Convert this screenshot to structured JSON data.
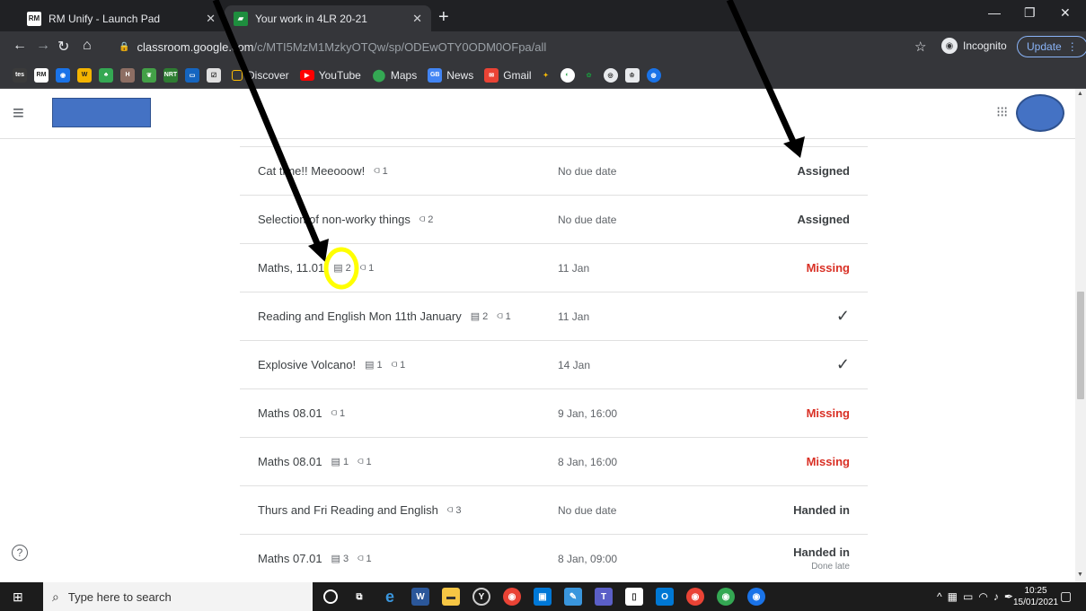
{
  "browser": {
    "tabs": [
      {
        "label": "RM Unify - Launch Pad",
        "favicon": "RM",
        "active": false
      },
      {
        "label": "Your work in 4LR 20-21",
        "favicon": "GC",
        "active": true
      }
    ],
    "url_host": "classroom.google.com",
    "url_path": "/c/MTI5MzM1MzkyOTQw/sp/ODEwOTY0ODM0OFpa/all",
    "incognito_label": "Incognito",
    "update_label": "Update",
    "bookmarks": [
      {
        "label": "Discover",
        "icon": "discover-icon"
      },
      {
        "label": "YouTube",
        "icon": "youtube-icon"
      },
      {
        "label": "Maps",
        "icon": "maps-icon"
      },
      {
        "label": "News",
        "icon": "news-icon"
      },
      {
        "label": "Gmail",
        "icon": "gmail-icon"
      }
    ],
    "colors": {
      "chrome_dark": "#202124",
      "chrome_toolbar": "#35363a",
      "accent_blue": "#8ab4f8"
    }
  },
  "work_items": [
    {
      "title": "Cat time!! Meeooow!",
      "comments": "",
      "attachments": "1",
      "due": "No due date",
      "status": "Assigned",
      "status_kind": "normal",
      "sub": ""
    },
    {
      "title": "Selection of non-worky things",
      "comments": "",
      "attachments": "2",
      "due": "No due date",
      "status": "Assigned",
      "status_kind": "normal",
      "sub": ""
    },
    {
      "title": "Maths, 11.01",
      "comments": "2",
      "attachments": "1",
      "due": "11 Jan",
      "status": "Missing",
      "status_kind": "missing",
      "sub": ""
    },
    {
      "title": "Reading and English Mon 11th January",
      "comments": "2",
      "attachments": "1",
      "due": "11 Jan",
      "status": "✓",
      "status_kind": "check",
      "sub": ""
    },
    {
      "title": "Explosive Volcano!",
      "comments": "1",
      "attachments": "1",
      "due": "14 Jan",
      "status": "✓",
      "status_kind": "check",
      "sub": ""
    },
    {
      "title": "Maths 08.01",
      "comments": "",
      "attachments": "1",
      "due": "9 Jan, 16:00",
      "status": "Missing",
      "status_kind": "missing",
      "sub": ""
    },
    {
      "title": "Maths 08.01",
      "comments": "1",
      "attachments": "1",
      "due": "8 Jan, 16:00",
      "status": "Missing",
      "status_kind": "missing",
      "sub": ""
    },
    {
      "title": "Thurs and Fri Reading and English",
      "comments": "",
      "attachments": "3",
      "due": "No due date",
      "status": "Handed in",
      "status_kind": "normal",
      "sub": ""
    },
    {
      "title": "Maths 07.01",
      "comments": "3",
      "attachments": "1",
      "due": "8 Jan, 09:00",
      "status": "Handed in",
      "status_kind": "normal",
      "sub": "Done late"
    }
  ],
  "status_colors": {
    "missing": "#d93025",
    "normal": "#3c4043"
  },
  "annotation": {
    "highlight_color": "#ffff00",
    "arrow_color": "#000000"
  },
  "taskbar": {
    "search_placeholder": "Type here to search",
    "time": "10:25",
    "date": "15/01/2021"
  }
}
